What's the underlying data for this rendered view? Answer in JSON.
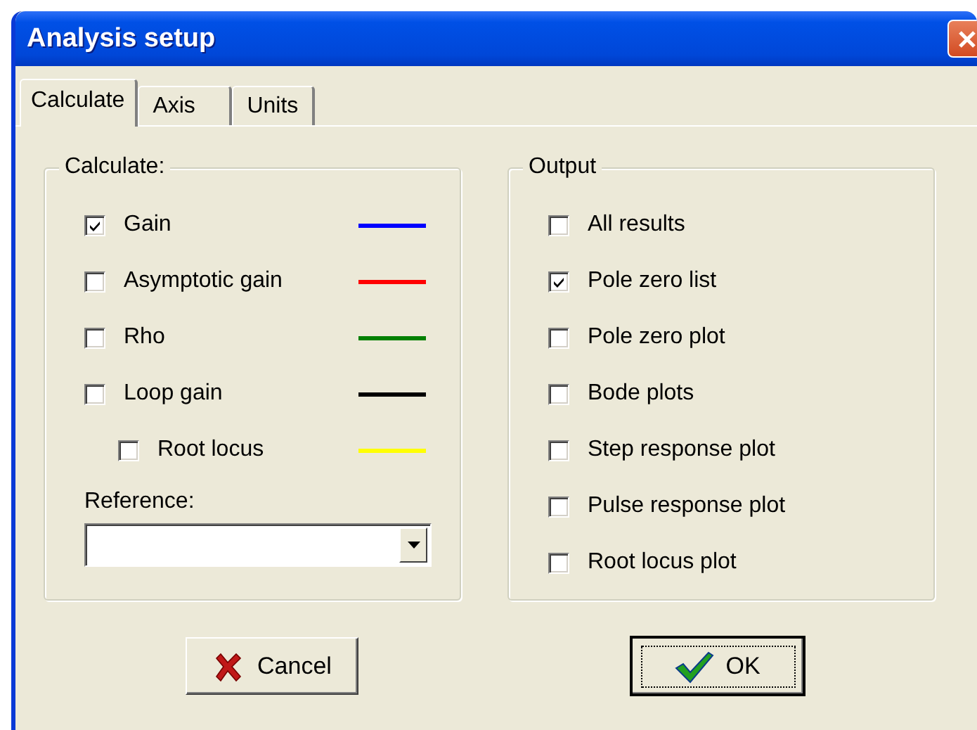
{
  "window": {
    "title": "Analysis setup"
  },
  "tabs": [
    {
      "label": "Calculate",
      "selected": true
    },
    {
      "label": "Axis",
      "selected": false
    },
    {
      "label": "Units",
      "selected": false
    }
  ],
  "calculate": {
    "title": "Calculate:",
    "items": [
      {
        "label": "Gain",
        "checked": true,
        "color": "#0000ff"
      },
      {
        "label": "Asymptotic gain",
        "checked": false,
        "color": "#ff0000"
      },
      {
        "label": "Rho",
        "checked": false,
        "color": "#008000"
      },
      {
        "label": "Loop gain",
        "checked": false,
        "color": "#000000",
        "children": [
          {
            "label": "Root locus",
            "checked": false,
            "color": "#ffff00"
          }
        ]
      }
    ]
  },
  "reference": {
    "label": "Reference:"
  },
  "output": {
    "title": "Output",
    "items": [
      {
        "label": "All results",
        "checked": false
      },
      {
        "label": "Pole zero list",
        "checked": true
      },
      {
        "label": "Pole zero plot",
        "checked": false
      },
      {
        "label": "Bode plots",
        "checked": false
      },
      {
        "label": "Step response plot",
        "checked": false
      },
      {
        "label": "Pulse response plot",
        "checked": false
      },
      {
        "label": "Root locus plot",
        "checked": false
      }
    ]
  },
  "buttons": [
    {
      "label": "Cancel",
      "kind": "cancel",
      "default": false
    },
    {
      "label": "OK",
      "kind": "ok",
      "default": true
    }
  ]
}
